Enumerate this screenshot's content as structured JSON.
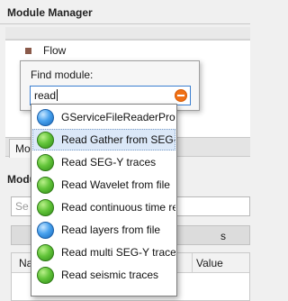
{
  "module_manager": {
    "title": "Module Manager",
    "tree": {
      "flow_label": "Flow"
    },
    "tab_partial": "Mo"
  },
  "lower_section": {
    "title_partial": "Modu",
    "search_partial": "Se",
    "tab_label_partial": "s",
    "columns": {
      "name_partial": "Na",
      "value": "Value"
    }
  },
  "find_module": {
    "label": "Find module:",
    "input_value": "read",
    "clear_icon": "clear-icon"
  },
  "suggestions": [
    {
      "label": "GServiceFileReaderProcedure",
      "icon": "blue",
      "selected": false
    },
    {
      "label": "Read Gather from SEG-Y",
      "icon": "green",
      "selected": true
    },
    {
      "label": "Read SEG-Y traces",
      "icon": "green",
      "selected": false
    },
    {
      "label": "Read Wavelet from file",
      "icon": "green",
      "selected": false
    },
    {
      "label": "Read continuous time receiver",
      "icon": "green",
      "selected": false
    },
    {
      "label": "Read layers from file",
      "icon": "blue",
      "selected": false
    },
    {
      "label": "Read multi SEG-Y traces",
      "icon": "green",
      "selected": false
    },
    {
      "label": "Read seismic traces",
      "icon": "green",
      "selected": false
    }
  ]
}
